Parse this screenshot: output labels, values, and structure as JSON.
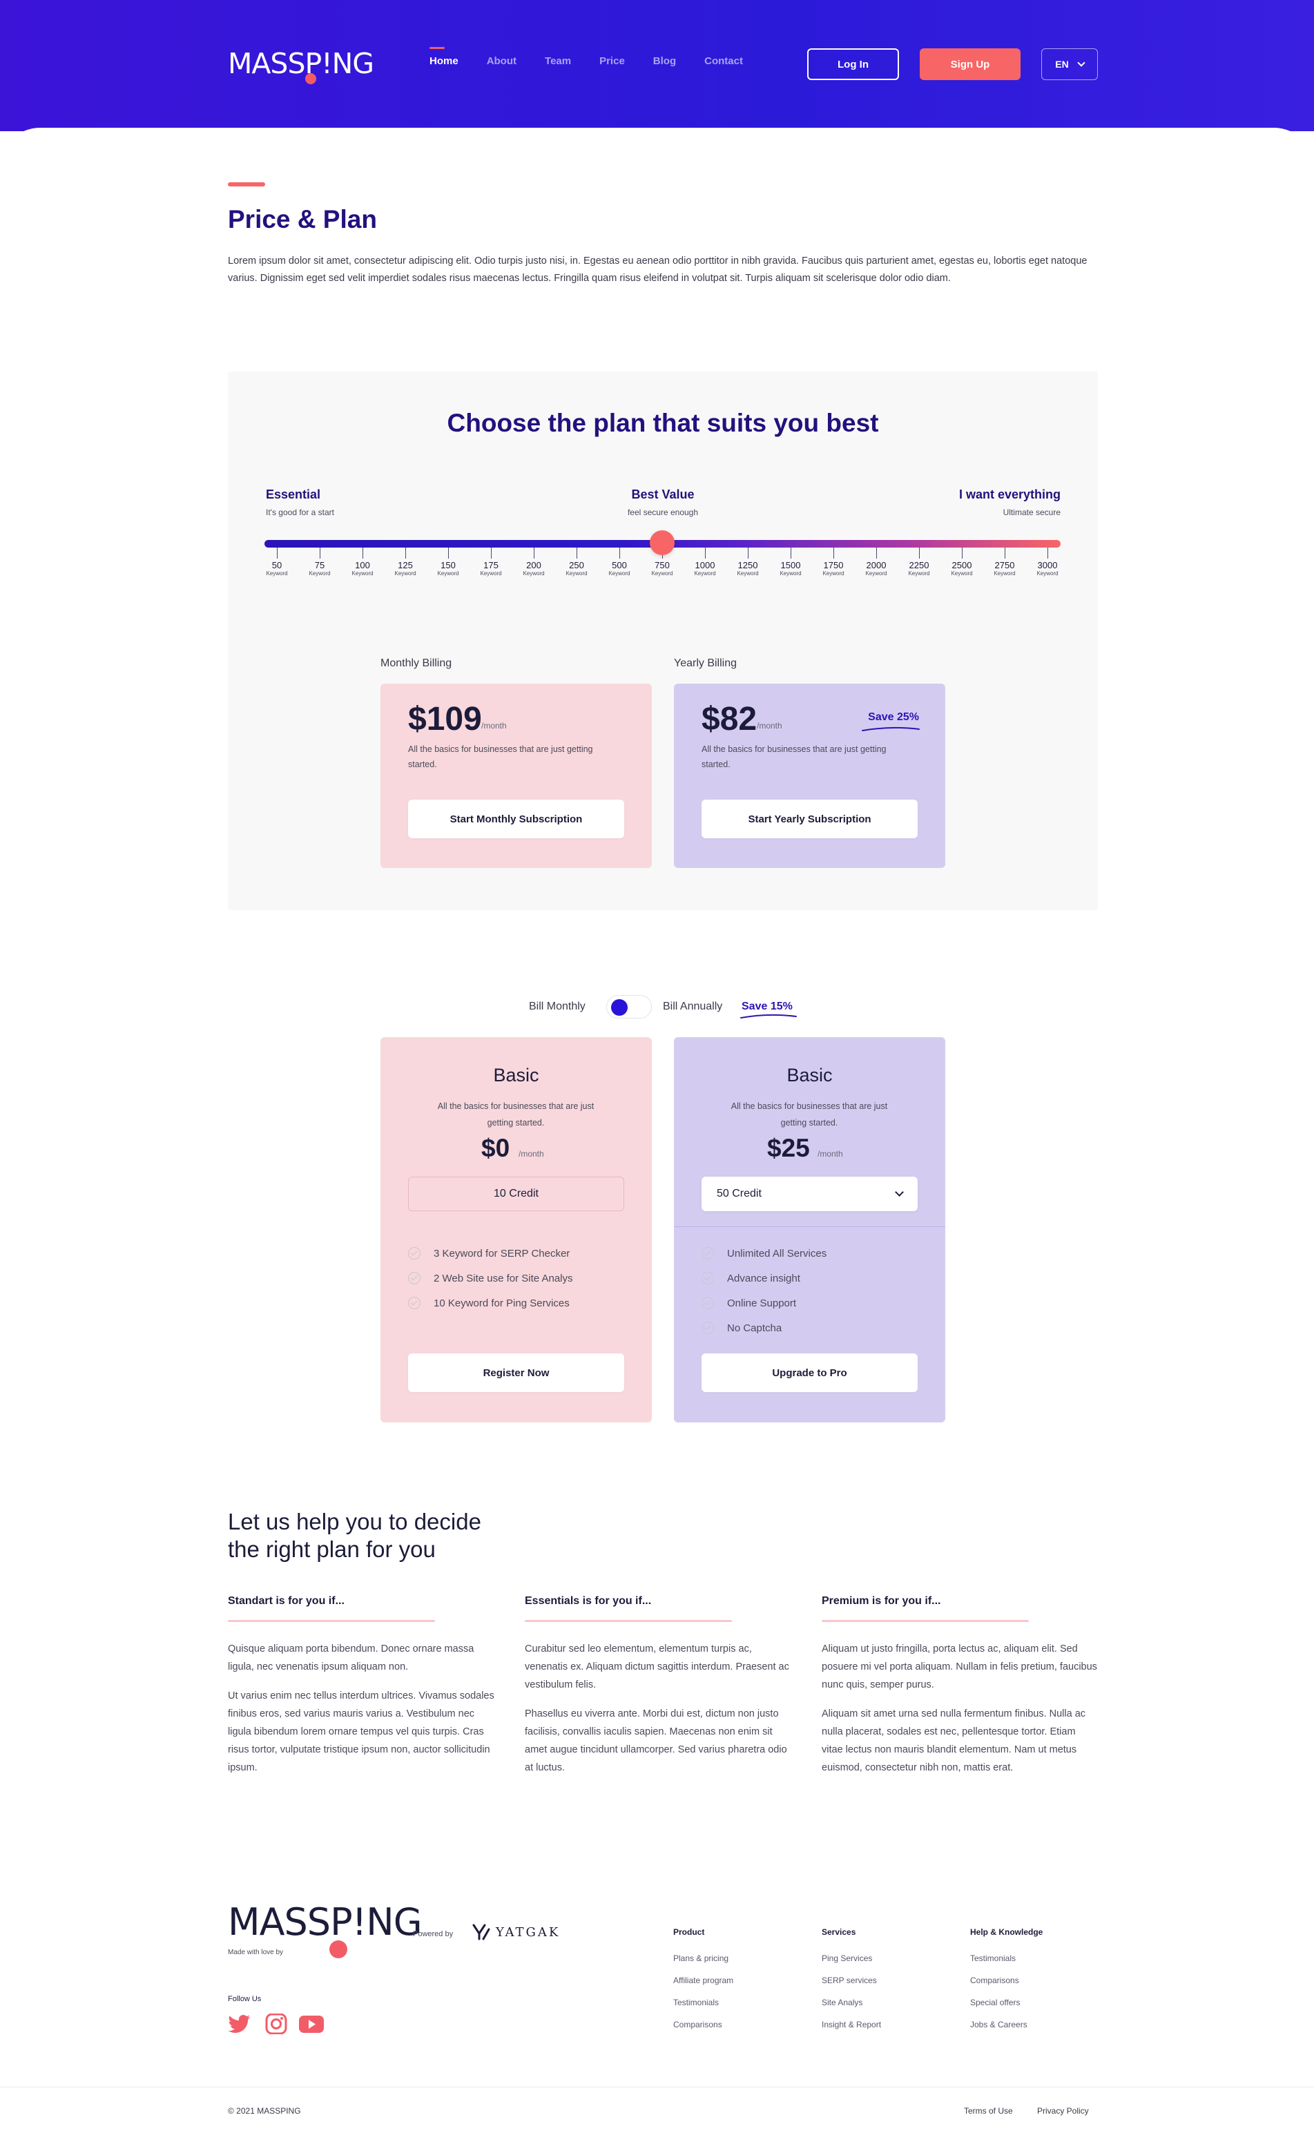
{
  "brand": {
    "logo": "MASSP!NG",
    "accent": "#f86566",
    "primary": "#2b14d8",
    "navy": "#23117d"
  },
  "header": {
    "nav": [
      "Home",
      "About",
      "Team",
      "Price",
      "Blog",
      "Contact"
    ],
    "active_nav": "Home",
    "login_label": "Log In",
    "signup_label": "Sign Up",
    "lang_label": "EN"
  },
  "intro": {
    "title": "Price & Plan",
    "body": "Lorem ipsum dolor sit amet, consectetur adipiscing elit. Odio turpis justo nisi, in. Egestas eu aenean odio porttitor in nibh gravida. Faucibus quis parturient amet, egestas eu, lobortis eget natoque varius. Dignissim eget sed velit imperdiet sodales risus maecenas lectus. Fringilla quam risus eleifend in volutpat sit. Turpis aliquam sit scelerisque dolor odio diam."
  },
  "slider_panel": {
    "title": "Choose the plan that suits you best",
    "tiers": [
      {
        "name": "Essential",
        "sub": "It's good for a start"
      },
      {
        "name": "Best Value",
        "sub": "feel secure enough"
      },
      {
        "name": "I want everything",
        "sub": "Ultimate secure"
      }
    ],
    "ticks": [
      "50",
      "75",
      "100",
      "125",
      "150",
      "175",
      "200",
      "250",
      "500",
      "750",
      "1000",
      "1250",
      "1500",
      "1750",
      "2000",
      "2250",
      "2500",
      "2750",
      "3000"
    ],
    "tick_unit": "Keyword",
    "selected_value": "750",
    "monthly": {
      "label": "Monthly Billing",
      "price": "$109",
      "per": "/month",
      "desc": "All the basics for businesses that are just getting started.",
      "button": "Start Monthly Subscription"
    },
    "yearly": {
      "label": "Yearly Billing",
      "price": "$82",
      "per": "/month",
      "save": "Save 25%",
      "desc": "All the basics for businesses that are just getting started.",
      "button": "Start Yearly Subscription"
    }
  },
  "toggle": {
    "bill_monthly": "Bill Monthly",
    "bill_annually": "Bill Annually",
    "save": "Save 15%",
    "is_annual": false
  },
  "plans": [
    {
      "name": "Basic",
      "desc": "All the basics for businesses that are just getting started.",
      "price": "$0",
      "per": "/month",
      "credit": "10 Credit",
      "features": [
        "3 Keyword for SERP Checker",
        "2 Web Site use for Site Analys",
        "10 Keyword for Ping Services"
      ],
      "button": "Register Now"
    },
    {
      "name": "Basic",
      "desc": "All the basics for businesses that are just getting started.",
      "price": "$25",
      "per": "/month",
      "credit": "50 Credit",
      "features": [
        "Unlimited All Services",
        "Advance insight",
        "Online Support",
        "No Captcha"
      ],
      "button": "Upgrade to Pro"
    }
  ],
  "help": {
    "title_line1": "Let us help you to decide",
    "title_line2": "the right plan for you",
    "columns": [
      {
        "heading": "Standart is for you if...",
        "p1": "Quisque aliquam porta bibendum. Donec ornare massa ligula, nec venenatis ipsum aliquam non.",
        "p2": "Ut varius enim nec tellus interdum ultrices. Vivamus sodales finibus eros, sed varius mauris varius a. Vestibulum nec ligula bibendum lorem ornare tempus vel quis turpis. Cras risus tortor, vulputate tristique ipsum non, auctor sollicitudin ipsum."
      },
      {
        "heading": "Essentials is for you if...",
        "p1": "Curabitur sed leo elementum, elementum turpis ac, venenatis ex. Aliquam dictum sagittis interdum. Praesent ac vestibulum felis.",
        "p2": "Phasellus eu viverra ante. Morbi dui est, dictum non justo facilisis, convallis iaculis sapien. Maecenas non enim sit amet augue tincidunt ullamcorper. Sed varius pharetra odio at luctus."
      },
      {
        "heading": "Premium is for you if...",
        "p1": "Aliquam ut justo fringilla, porta lectus ac, aliquam elit. Sed posuere mi vel porta aliquam. Nullam in felis pretium, faucibus nunc quis, semper purus.",
        "p2": "Aliquam sit amet urna sed nulla fermentum finibus. Nulla ac nulla placerat, sodales est nec, pellentesque tortor. Etiam vitae lectus non mauris blandit elementum. Nam ut metus euismod, consectetur nibh non, mattis erat."
      }
    ]
  },
  "footer": {
    "logo": "MASSP!NG",
    "made_with": "Made with love by",
    "powered_by": "Powered by",
    "partner": "YATGAK",
    "follow": "Follow Us",
    "social_icons": [
      "twitter-icon",
      "instagram-icon",
      "youtube-icon"
    ],
    "columns": [
      {
        "heading": "Product",
        "links": [
          "Plans & pricing",
          "Affiliate program",
          "Testimonials",
          "Comparisons"
        ]
      },
      {
        "heading": "Services",
        "links": [
          "Ping Services",
          "SERP services",
          "Site Analys",
          "Insight & Report"
        ]
      },
      {
        "heading": "Help & Knowledge",
        "links": [
          "Testimonials",
          "Comparisons",
          "Special offers",
          "Jobs & Careers"
        ]
      }
    ],
    "copyright": "© 2021 MASSPING",
    "terms": "Terms of Use",
    "privacy": "Privacy Policy"
  }
}
